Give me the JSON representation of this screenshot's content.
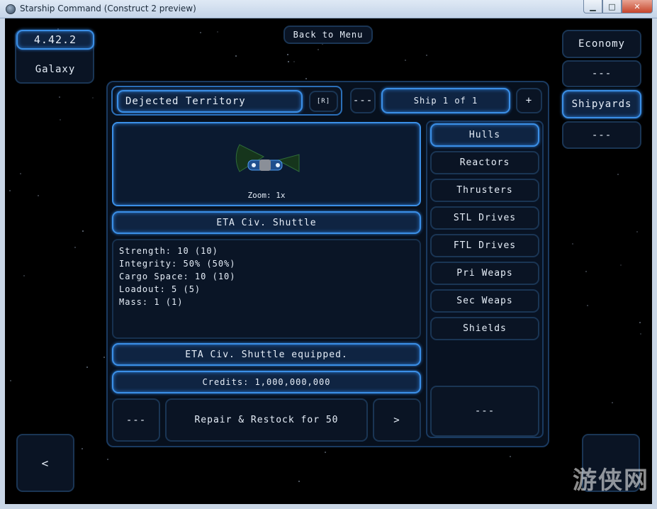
{
  "window": {
    "title": "Starship Command (Construct 2 preview)",
    "min": "▁",
    "max": "□",
    "close": "✕"
  },
  "top_left": {
    "version": "4.42.2",
    "galaxy": "Galaxy"
  },
  "back_to_menu": "Back to Menu",
  "top_right": {
    "economy": "Economy",
    "slot2": "---",
    "shipyards": "Shipyards",
    "slot4": "---"
  },
  "header": {
    "territory": "Dejected Territory",
    "rename": "[R]",
    "prev": "---",
    "ship_counter": "Ship 1 of 1",
    "add": "+"
  },
  "ship_view": {
    "zoom": "Zoom: 1x"
  },
  "ship_name": "ETA Civ. Shuttle",
  "stats": [
    "Strength: 10 (10)",
    "Integrity: 50% (50%)",
    "Cargo Space: 10 (10)",
    "Loadout: 5 (5)",
    "Mass: 1 (1)"
  ],
  "status_message": "ETA Civ. Shuttle equipped.",
  "credits": "Credits: 1,000,000,000",
  "bottom": {
    "left": "---",
    "repair": "Repair & Restock for 50",
    "next": ">"
  },
  "categories": [
    "Hulls",
    "Reactors",
    "Thrusters",
    "STL Drives",
    "FTL Drives",
    "Pri Weaps",
    "Sec Weaps",
    "Shields"
  ],
  "selected_category": "Hulls",
  "right_info": "---",
  "nav": {
    "left": "<"
  },
  "watermark": "游侠网",
  "colors": {
    "accent": "#3b8fe6",
    "panel": "#0d1a2c",
    "text": "#e6eef8"
  }
}
